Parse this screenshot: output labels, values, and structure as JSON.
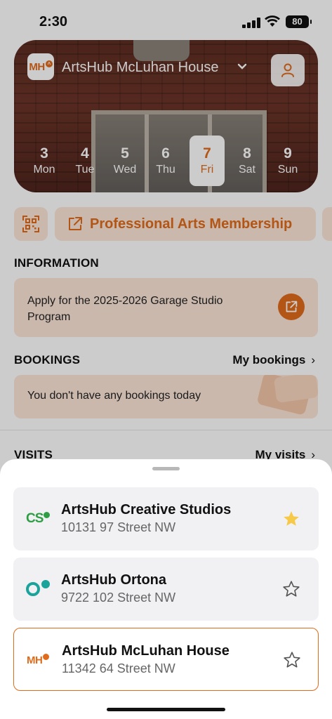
{
  "status_bar": {
    "time": "2:30",
    "battery": "80"
  },
  "header": {
    "location_logo": "MH",
    "location_name": "ArtsHub McLuhan House",
    "profile_icon": "person-icon"
  },
  "calendar": {
    "days": [
      {
        "num": "3",
        "name": "Mon"
      },
      {
        "num": "4",
        "name": "Tue"
      },
      {
        "num": "5",
        "name": "Wed"
      },
      {
        "num": "6",
        "name": "Thu"
      },
      {
        "num": "7",
        "name": "Fri"
      },
      {
        "num": "8",
        "name": "Sat"
      },
      {
        "num": "9",
        "name": "Sun"
      }
    ],
    "selected": "7"
  },
  "actions": {
    "membership_label": "Professional Arts Membership"
  },
  "information": {
    "title": "INFORMATION",
    "card_text": "Apply for the 2025-2026 Garage Studio Program"
  },
  "bookings": {
    "title": "BOOKINGS",
    "link": "My bookings",
    "empty_text": "You don't have any bookings today"
  },
  "visits": {
    "title": "VISITS",
    "link": "My visits"
  },
  "location_sheet": {
    "items": [
      {
        "logo": "CS",
        "name": "ArtsHub Creative Studios",
        "address": "10131 97 Street NW",
        "favorite": true
      },
      {
        "logo": "O",
        "name": "ArtsHub Ortona",
        "address": "9722 102 Street NW",
        "favorite": false
      },
      {
        "logo": "MH",
        "name": "ArtsHub McLuhan House",
        "address": "11342 64 Street NW",
        "favorite": false,
        "selected": true
      }
    ]
  },
  "colors": {
    "accent": "#e06b1b",
    "accent_soft": "#fde6d8",
    "green": "#2e9e44",
    "teal": "#1aa39a",
    "star": "#f7c948"
  }
}
